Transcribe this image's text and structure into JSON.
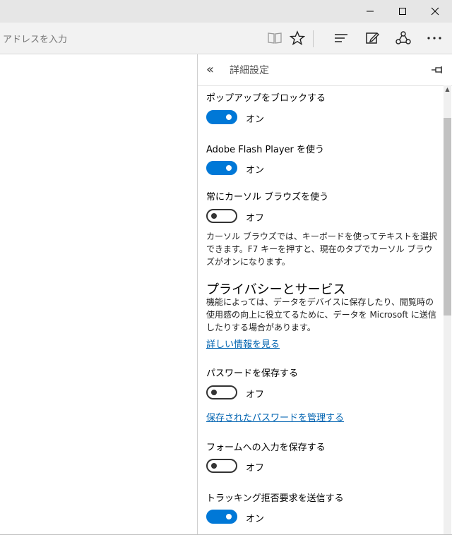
{
  "window": {
    "controls": {
      "minimize": "minimize",
      "maximize": "maximize",
      "close": "close"
    }
  },
  "address": {
    "placeholder": "アドレスを入力"
  },
  "toolbar": {
    "icons": [
      "reading-view-icon",
      "favorites-star-icon",
      "hub-icon",
      "web-note-icon",
      "share-icon",
      "more-icon"
    ]
  },
  "panel": {
    "title": "詳細設定",
    "settings": [
      {
        "label": "ポップアップをブロックする",
        "state": "オン",
        "on": true
      },
      {
        "label": "Adobe Flash Player を使う",
        "state": "オン",
        "on": true
      },
      {
        "label": "常にカーソル ブラウズを使う",
        "state": "オフ",
        "on": false,
        "description": "カーソル ブラウズでは、キーボードを使ってテキストを選択できます。F7 キーを押すと、現在のタブでカーソル ブラウズがオンになります。"
      },
      {
        "label": "パスワードを保存する",
        "state": "オフ",
        "on": false
      },
      {
        "label": "フォームへの入力を保存する",
        "state": "オフ",
        "on": false
      },
      {
        "label": "トラッキング拒否要求を送信する",
        "state": "オン",
        "on": true
      }
    ],
    "privacy": {
      "title": "プライバシーとサービス",
      "description": "機能によっては、データをデバイスに保存したり、閲覧時の使用感の向上に役立てるために、データを Microsoft に送信したりする場合があります。",
      "link": "詳しい情報を見る"
    },
    "manage_passwords_link": "保存されたパスワードを管理する"
  }
}
